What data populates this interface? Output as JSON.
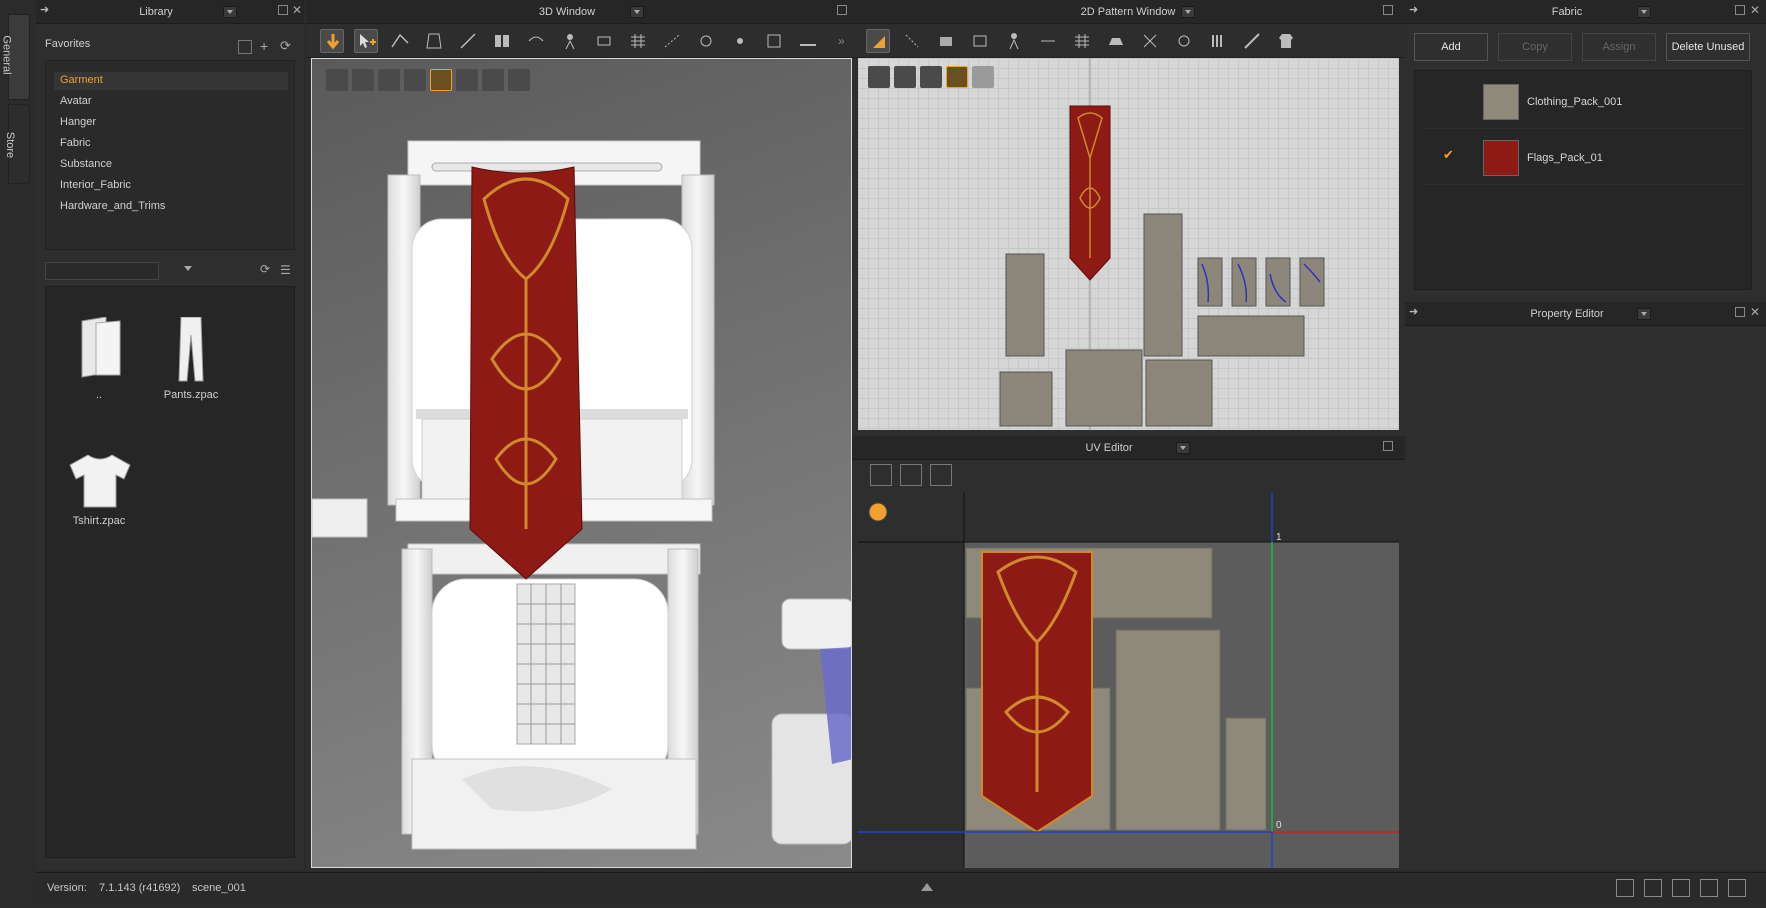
{
  "side_tabs": {
    "general": "General",
    "store": "Store"
  },
  "library": {
    "title": "Library",
    "favorites_label": "Favorites",
    "favorites": [
      "Garment",
      "Avatar",
      "Hanger",
      "Fabric",
      "Substance",
      "Interior_Fabric",
      "Hardware_and_Trims"
    ],
    "selected": "Garment",
    "search_value": "",
    "files": [
      {
        "name": "..",
        "icon": "folder-icon"
      },
      {
        "name": "Pants.zpac",
        "icon": "pants-icon"
      },
      {
        "name": "Tshirt.zpac",
        "icon": "tshirt-icon"
      }
    ]
  },
  "window_3d": {
    "title": "3D Window"
  },
  "window_2d": {
    "title": "2D Pattern Window"
  },
  "uv_editor": {
    "title": "UV Editor",
    "axis_u_label": "1",
    "axis_origin_label": "0"
  },
  "fabric": {
    "title": "Fabric",
    "buttons": {
      "add": "Add",
      "copy": "Copy",
      "assign": "Assign",
      "delete_unused": "Delete Unused"
    },
    "items": [
      {
        "name": "Clothing_Pack_001",
        "checked": false
      },
      {
        "name": "Flags_Pack_01",
        "checked": true
      }
    ]
  },
  "property_editor": {
    "title": "Property Editor"
  },
  "status": {
    "version_label": "Version:",
    "version_value": "7.1.143 (r41692)",
    "scene": "scene_001"
  },
  "colors": {
    "accent": "#f0a030",
    "flag_red": "#8e1a16",
    "flag_gold": "#d08a2a",
    "uv_blue": "#1f3fd8",
    "uv_green": "#22c022",
    "uv_red": "#d02020"
  }
}
